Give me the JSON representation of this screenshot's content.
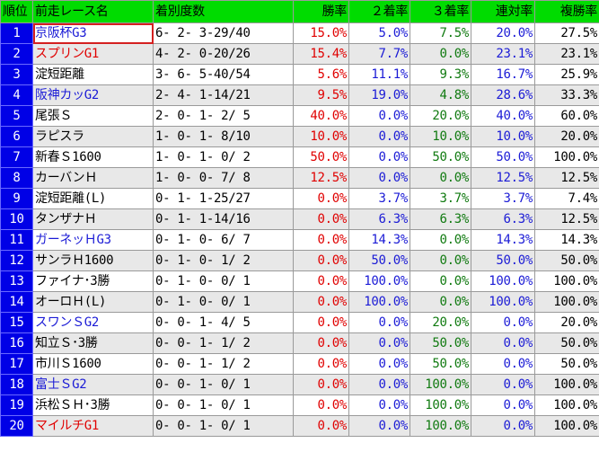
{
  "headers": {
    "rank": "順位",
    "race": "前走レース名",
    "record": "着別度数",
    "win": "勝率",
    "second": "２着率",
    "third": "３着率",
    "quinella": "連対率",
    "show": "複勝率"
  },
  "colors": {
    "header_bg": "#00dc00",
    "rank_bg": "#0000e6",
    "g3_text": "#1b1bd6",
    "g1_text": "#e00000",
    "win_text": "#e00000",
    "second_text": "#1b1bd6",
    "third_text": "#107a10",
    "quinella_text": "#1b1bd6",
    "show_text": "#000000"
  },
  "rows": [
    {
      "rank": "1",
      "race": "京阪杯G3",
      "grade": "blue",
      "record": "6- 2- 3-29/40",
      "win": "15.0%",
      "second": "5.0%",
      "third": "7.5%",
      "quinella": "20.0%",
      "show": "27.5%"
    },
    {
      "rank": "2",
      "race": "スプリンG1",
      "grade": "red",
      "record": "4- 2- 0-20/26",
      "win": "15.4%",
      "second": "7.7%",
      "third": "0.0%",
      "quinella": "23.1%",
      "show": "23.1%"
    },
    {
      "rank": "3",
      "race": "淀短距離",
      "grade": "black",
      "record": "3- 6- 5-40/54",
      "win": "5.6%",
      "second": "11.1%",
      "third": "9.3%",
      "quinella": "16.7%",
      "show": "25.9%"
    },
    {
      "rank": "4",
      "race": "阪神カッG2",
      "grade": "blue",
      "record": "2- 4- 1-14/21",
      "win": "9.5%",
      "second": "19.0%",
      "third": "4.8%",
      "quinella": "28.6%",
      "show": "33.3%"
    },
    {
      "rank": "5",
      "race": "尾張Ｓ",
      "grade": "black",
      "record": "2- 0- 1- 2/ 5",
      "win": "40.0%",
      "second": "0.0%",
      "third": "20.0%",
      "quinella": "40.0%",
      "show": "60.0%"
    },
    {
      "rank": "6",
      "race": "ラピスラ",
      "grade": "black",
      "record": "1- 0- 1- 8/10",
      "win": "10.0%",
      "second": "0.0%",
      "third": "10.0%",
      "quinella": "10.0%",
      "show": "20.0%"
    },
    {
      "rank": "7",
      "race": "新春Ｓ1600",
      "grade": "black",
      "record": "1- 0- 1- 0/ 2",
      "win": "50.0%",
      "second": "0.0%",
      "third": "50.0%",
      "quinella": "50.0%",
      "show": "100.0%"
    },
    {
      "rank": "8",
      "race": "カーバンＨ",
      "grade": "black",
      "record": "1- 0- 0- 7/ 8",
      "win": "12.5%",
      "second": "0.0%",
      "third": "0.0%",
      "quinella": "12.5%",
      "show": "12.5%"
    },
    {
      "rank": "9",
      "race": "淀短距離(L)",
      "grade": "black",
      "record": "0- 1- 1-25/27",
      "win": "0.0%",
      "second": "3.7%",
      "third": "3.7%",
      "quinella": "3.7%",
      "show": "7.4%"
    },
    {
      "rank": "10",
      "race": "タンザナＨ",
      "grade": "black",
      "record": "0- 1- 1-14/16",
      "win": "0.0%",
      "second": "6.3%",
      "third": "6.3%",
      "quinella": "6.3%",
      "show": "12.5%"
    },
    {
      "rank": "11",
      "race": "ガーネッＨG3",
      "grade": "blue",
      "record": "0- 1- 0- 6/ 7",
      "win": "0.0%",
      "second": "14.3%",
      "third": "0.0%",
      "quinella": "14.3%",
      "show": "14.3%"
    },
    {
      "rank": "12",
      "race": "サンラＨ1600",
      "grade": "black",
      "record": "0- 1- 0- 1/ 2",
      "win": "0.0%",
      "second": "50.0%",
      "third": "0.0%",
      "quinella": "50.0%",
      "show": "50.0%"
    },
    {
      "rank": "13",
      "race": "ファイナ･3勝",
      "grade": "black",
      "record": "0- 1- 0- 0/ 1",
      "win": "0.0%",
      "second": "100.0%",
      "third": "0.0%",
      "quinella": "100.0%",
      "show": "100.0%"
    },
    {
      "rank": "14",
      "race": "オーロＨ(L)",
      "grade": "black",
      "record": "0- 1- 0- 0/ 1",
      "win": "0.0%",
      "second": "100.0%",
      "third": "0.0%",
      "quinella": "100.0%",
      "show": "100.0%"
    },
    {
      "rank": "15",
      "race": "スワンＳG2",
      "grade": "blue",
      "record": "0- 0- 1- 4/ 5",
      "win": "0.0%",
      "second": "0.0%",
      "third": "20.0%",
      "quinella": "0.0%",
      "show": "20.0%"
    },
    {
      "rank": "16",
      "race": "知立Ｓ･3勝",
      "grade": "black",
      "record": "0- 0- 1- 1/ 2",
      "win": "0.0%",
      "second": "0.0%",
      "third": "50.0%",
      "quinella": "0.0%",
      "show": "50.0%"
    },
    {
      "rank": "17",
      "race": "市川Ｓ1600",
      "grade": "black",
      "record": "0- 0- 1- 1/ 2",
      "win": "0.0%",
      "second": "0.0%",
      "third": "50.0%",
      "quinella": "0.0%",
      "show": "50.0%"
    },
    {
      "rank": "18",
      "race": "富士ＳG2",
      "grade": "blue",
      "record": "0- 0- 1- 0/ 1",
      "win": "0.0%",
      "second": "0.0%",
      "third": "100.0%",
      "quinella": "0.0%",
      "show": "100.0%"
    },
    {
      "rank": "19",
      "race": "浜松ＳＨ･3勝",
      "grade": "black",
      "record": "0- 0- 1- 0/ 1",
      "win": "0.0%",
      "second": "0.0%",
      "third": "100.0%",
      "quinella": "0.0%",
      "show": "100.0%"
    },
    {
      "rank": "20",
      "race": "マイルチG1",
      "grade": "red",
      "record": "0- 0- 1- 0/ 1",
      "win": "0.0%",
      "second": "0.0%",
      "third": "100.0%",
      "quinella": "0.0%",
      "show": "100.0%"
    }
  ]
}
